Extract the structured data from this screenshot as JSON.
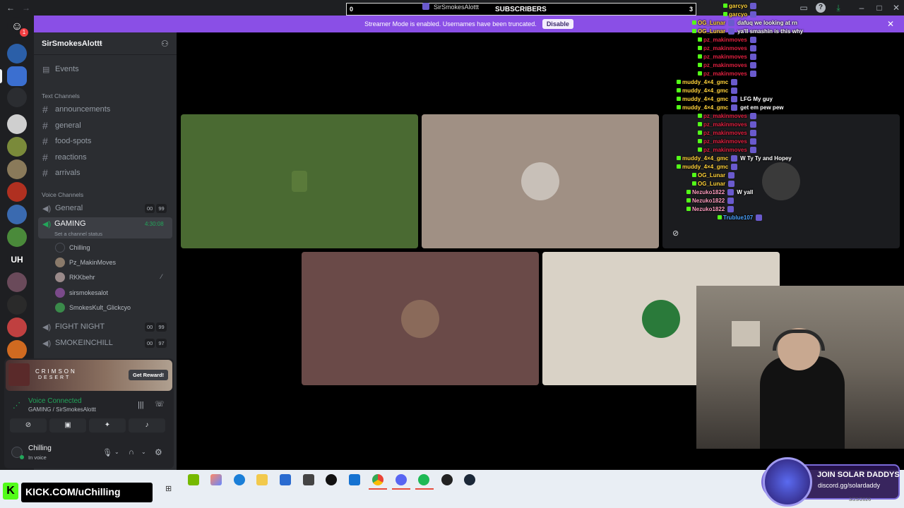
{
  "overlay": {
    "subs_start": "0",
    "subs_label": "SUBSCRIBERS",
    "subs_goal": "3",
    "recent_sub": "SirSmokesAlottt"
  },
  "streamer_bar": {
    "message": "Streamer Mode is enabled. Usernames have been truncated.",
    "disable_label": "Disable"
  },
  "server_rail": {
    "dm_badge": "1",
    "uh_label": "UH"
  },
  "guild": {
    "name": "SirSmokesAlottt"
  },
  "sidebar": {
    "events_label": "Events",
    "text_category": "Text Channels",
    "text_channels": [
      "announcements",
      "general",
      "food-spots",
      "reactions",
      "arrivals"
    ],
    "voice_category": "Voice Channels",
    "voice_general": {
      "name": "General",
      "a": "00",
      "b": "99"
    },
    "gaming": {
      "name": "GAMING",
      "timer": "4:30:08",
      "status": "Set a channel status"
    },
    "voice_users": [
      "Chilling",
      "Pz_MakinMoves",
      "RKKbehr",
      "sirsmokesalot",
      "SmokesKult_Glickcyo"
    ],
    "fight_night": {
      "name": "FIGHT NIGHT",
      "a": "00",
      "b": "99"
    },
    "smokeinchill": {
      "name": "SMOKEINCHILL",
      "a": "00",
      "b": "97"
    }
  },
  "promo": {
    "title": "CRIMSON",
    "subtitle": "DESERT",
    "cta": "Get Reward!"
  },
  "voice": {
    "status": "Voice Connected",
    "channel": "GAMING / SirSmokesAlottt"
  },
  "user": {
    "name": "Chilling",
    "status": "In voice"
  },
  "chat": [
    {
      "user": "garcyo",
      "color": "#ffd23a",
      "msg": ""
    },
    {
      "user": "garcyo",
      "color": "#ffd23a",
      "msg": ""
    },
    {
      "user": "OG_Lunar",
      "color": "#ffd23a",
      "msg": "dafuq we looking at rn"
    },
    {
      "user": "OG_Lunar",
      "color": "#ffd23a",
      "msg": "ya'll smashin is this why"
    },
    {
      "user": "pz_makinmoves",
      "color": "#e02040",
      "msg": ""
    },
    {
      "user": "pz_makinmoves",
      "color": "#e02040",
      "msg": ""
    },
    {
      "user": "pz_makinmoves",
      "color": "#e02040",
      "msg": ""
    },
    {
      "user": "pz_makinmoves",
      "color": "#e02040",
      "msg": ""
    },
    {
      "user": "pz_makinmoves",
      "color": "#e02040",
      "msg": ""
    },
    {
      "user": "muddy_4×4_gmc",
      "color": "#ffd23a",
      "msg": ""
    },
    {
      "user": "muddy_4×4_gmc",
      "color": "#ffd23a",
      "msg": ""
    },
    {
      "user": "muddy_4×4_gmc",
      "color": "#ffd23a",
      "msg": "LFG My guy"
    },
    {
      "user": "muddy_4×4_gmc",
      "color": "#ffd23a",
      "msg": "get em pew pew"
    },
    {
      "user": "pz_makinmoves",
      "color": "#e02040",
      "msg": ""
    },
    {
      "user": "pz_makinmoves",
      "color": "#e02040",
      "msg": ""
    },
    {
      "user": "pz_makinmoves",
      "color": "#e02040",
      "msg": ""
    },
    {
      "user": "pz_makinmoves",
      "color": "#e02040",
      "msg": ""
    },
    {
      "user": "pz_makinmoves",
      "color": "#e02040",
      "msg": ""
    },
    {
      "user": "muddy_4×4_gmc",
      "color": "#ffd23a",
      "msg": "W Ty Ty and Hopey"
    },
    {
      "user": "muddy_4×4_gmc",
      "color": "#ffd23a",
      "msg": ""
    },
    {
      "user": "OG_Lunar",
      "color": "#ffd23a",
      "msg": ""
    },
    {
      "user": "OG_Lunar",
      "color": "#ffd23a",
      "msg": ""
    },
    {
      "user": "Nezuko1822",
      "color": "#ff9dc0",
      "msg": "W yall"
    },
    {
      "user": "Nezuko1822",
      "color": "#ff9dc0",
      "msg": ""
    },
    {
      "user": "Nezuko1822",
      "color": "#ff9dc0",
      "msg": ""
    },
    {
      "user": "Trublue107",
      "color": "#4aa3ff",
      "msg": ""
    }
  ],
  "kick_banner": {
    "text": "KICK.COM/uChilling"
  },
  "solar": {
    "title": "JOIN SOLAR DADDYS",
    "link": "discord.gg/solardaddy",
    "date": "3/25/2026"
  },
  "colors": {
    "discord_purple": "#8a4fe6",
    "voice_green": "#23a55a",
    "kick_green": "#53fc18"
  },
  "icons": [
    "discord-icon",
    "user-plus-icon",
    "hash-icon",
    "speaker-icon",
    "mic-icon",
    "headphones-icon",
    "gear-icon",
    "close-icon",
    "chevron-down-icon"
  ]
}
